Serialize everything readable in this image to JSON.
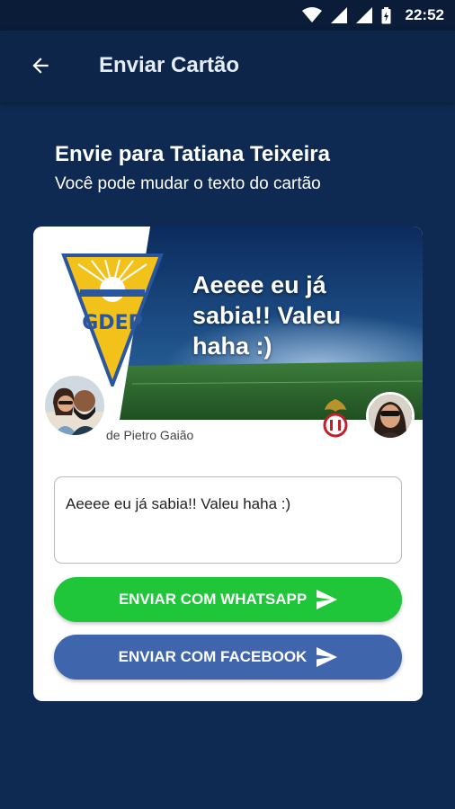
{
  "status_bar": {
    "time": "22:52",
    "icons": [
      "wifi-icon",
      "signal-icon",
      "signal-icon",
      "battery-icon"
    ]
  },
  "app_bar": {
    "title": "Enviar Cartão",
    "back_icon": "arrow-left-icon"
  },
  "header": {
    "title": "Envie para Tatiana Teixeira",
    "subtitle": "Você pode mudar o texto do cartão"
  },
  "card": {
    "message": "Aeeee eu já sabia!! Valeu haha :)",
    "byline": "de Pietro Gaião",
    "logo_letters": "GDEP",
    "crest_icon": "club-crest-icon"
  },
  "form": {
    "message_value": "Aeeee eu já sabia!! Valeu haha :)"
  },
  "actions": {
    "whatsapp_label": "ENVIAR COM WHATSAPP",
    "facebook_label": "ENVIAR COM FACEBOOK"
  },
  "colors": {
    "background": "#0f2a52",
    "app_bar": "#0c2548",
    "whatsapp": "#1fc63a",
    "facebook": "#3f65ad"
  }
}
